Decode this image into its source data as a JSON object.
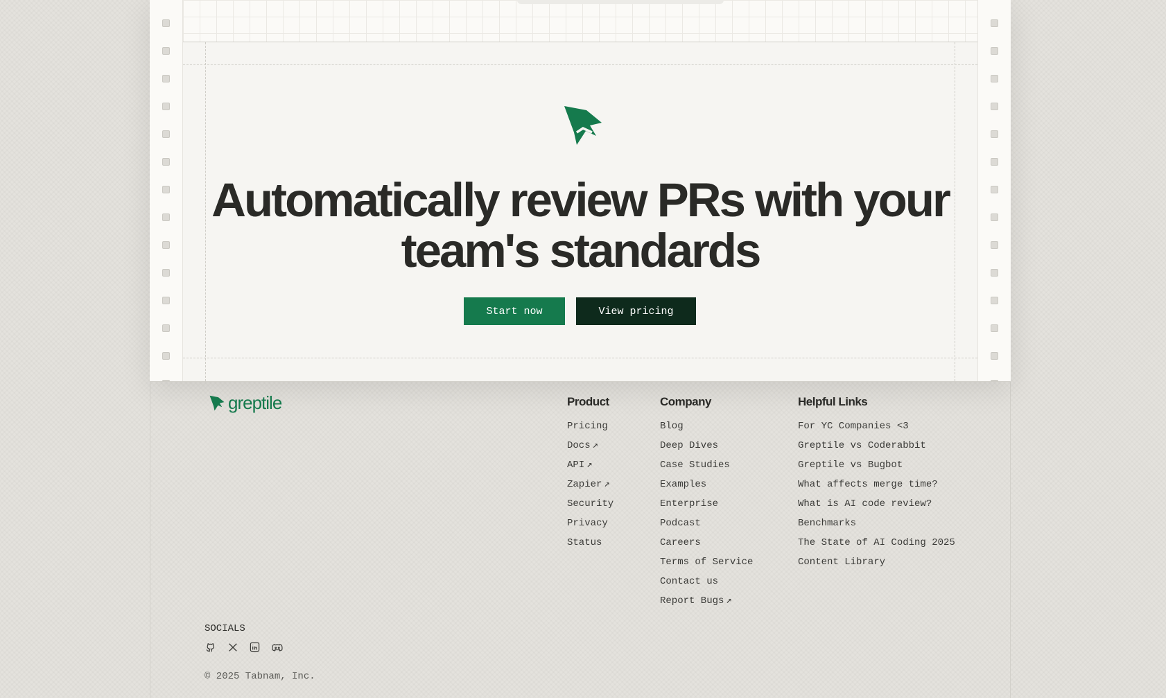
{
  "hero": {
    "headline": "Automatically review PRs with your team's standards",
    "start_label": "Start now",
    "pricing_label": "View pricing"
  },
  "brand": {
    "name": "greptile",
    "color": "#157a4d",
    "dark": "#0e2a1c",
    "logo_icon": "greptile-logo-icon"
  },
  "footer": {
    "product": {
      "title": "Product",
      "items": [
        {
          "label": "Pricing",
          "external": false
        },
        {
          "label": "Docs",
          "external": true
        },
        {
          "label": "API",
          "external": true
        },
        {
          "label": "Zapier",
          "external": true
        },
        {
          "label": "Security",
          "external": false
        },
        {
          "label": "Privacy",
          "external": false
        },
        {
          "label": "Status",
          "external": false
        }
      ]
    },
    "company": {
      "title": "Company",
      "items": [
        {
          "label": "Blog",
          "external": false
        },
        {
          "label": "Deep Dives",
          "external": false
        },
        {
          "label": "Case Studies",
          "external": false
        },
        {
          "label": "Examples",
          "external": false
        },
        {
          "label": "Enterprise",
          "external": false
        },
        {
          "label": "Podcast",
          "external": false
        },
        {
          "label": "Careers",
          "external": false
        },
        {
          "label": "Terms of Service",
          "external": false
        },
        {
          "label": "Contact us",
          "external": false
        },
        {
          "label": "Report Bugs",
          "external": true
        }
      ]
    },
    "helpful": {
      "title": "Helpful Links",
      "items": [
        {
          "label": "For YC Companies <3",
          "external": false
        },
        {
          "label": "Greptile vs Coderabbit",
          "external": false
        },
        {
          "label": "Greptile vs Bugbot",
          "external": false
        },
        {
          "label": "What affects merge time?",
          "external": false
        },
        {
          "label": "What is AI code review?",
          "external": false
        },
        {
          "label": "Benchmarks",
          "external": false
        },
        {
          "label": "The State of AI Coding 2025",
          "external": false
        },
        {
          "label": "Content Library",
          "external": false
        }
      ]
    },
    "socials_label": "SOCIALS",
    "socials": [
      "github-icon",
      "x-icon",
      "linkedin-icon",
      "discord-icon"
    ],
    "copyright": "© 2025 Tabnam, Inc."
  }
}
